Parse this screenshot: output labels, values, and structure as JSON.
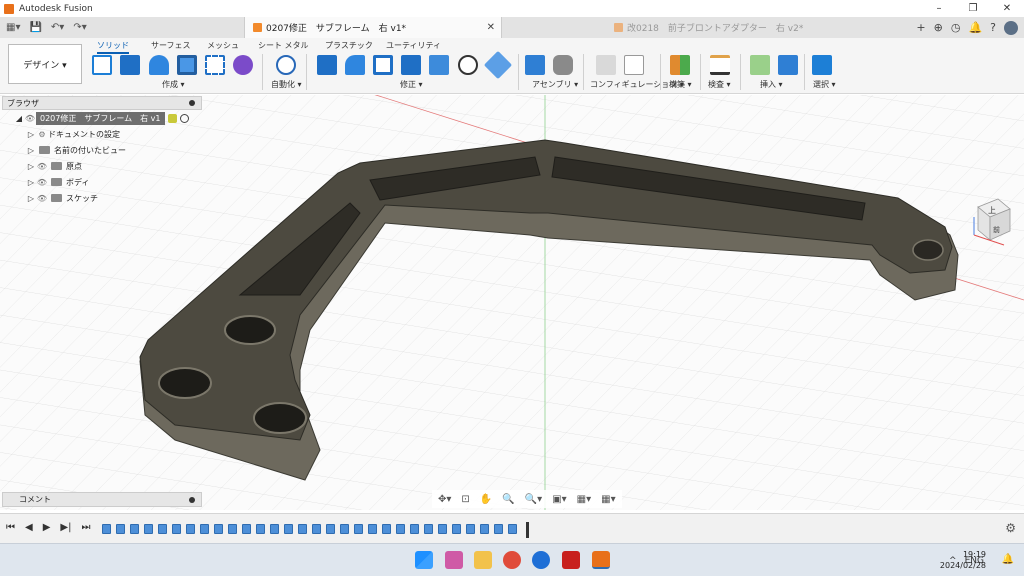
{
  "window": {
    "title": "Autodesk Fusion",
    "controls": [
      "–",
      "❐",
      "✕"
    ]
  },
  "quick_access": [
    "▦▾",
    "💾",
    "↶▾",
    "↷▾"
  ],
  "tabs": [
    {
      "label": "0207修正　サブフレーム　右 v1*",
      "close": "✕",
      "active": true
    },
    {
      "label": "改0218　前子ブロントアダプター　右 v2*",
      "active": false
    }
  ],
  "tab_right_icons": [
    "+",
    "⊕",
    "◷",
    "🔔",
    "?"
  ],
  "ribbon": {
    "workspace": "デザイン ▾",
    "tabs": [
      "ソリッド",
      "サーフェス",
      "メッシュ",
      "シート メタル",
      "プラスチック",
      "ユーティリティ"
    ],
    "groups": [
      "作成 ▾",
      "自動化 ▾",
      "修正 ▾",
      "アセンブリ ▾",
      "コンフィギュレーション ▾",
      "構築 ▾",
      "検査 ▾",
      "挿入 ▾",
      "選択 ▾"
    ]
  },
  "browser": {
    "title": "ブラウザ",
    "root": "0207修正　サブフレーム　右 v1",
    "items": [
      "ドキュメントの設定",
      "名前の付いたビュー",
      "原点",
      "ボディ",
      "スケッチ"
    ]
  },
  "comments": {
    "title": "コメント"
  },
  "navbar": [
    "✥▾",
    "⊡",
    "✋",
    "🔍",
    "🔍▾",
    "▣▾",
    "▦▾",
    "▦▾"
  ],
  "viewcube": {
    "top": "上",
    "front": "前"
  },
  "timeline": {
    "controls": [
      "⏮",
      "◀",
      "▶",
      "▶|",
      "⏭"
    ],
    "settings": "⚙"
  },
  "colors": {
    "part_top": "#4d4a40",
    "part_side": "#6d695d",
    "accent": "#0a5fb3",
    "fusion_orange": "#e8701a"
  },
  "taskbar": {
    "tray": [
      "^",
      "ENG"
    ],
    "time": "19:19",
    "date": "2024/02/28"
  }
}
